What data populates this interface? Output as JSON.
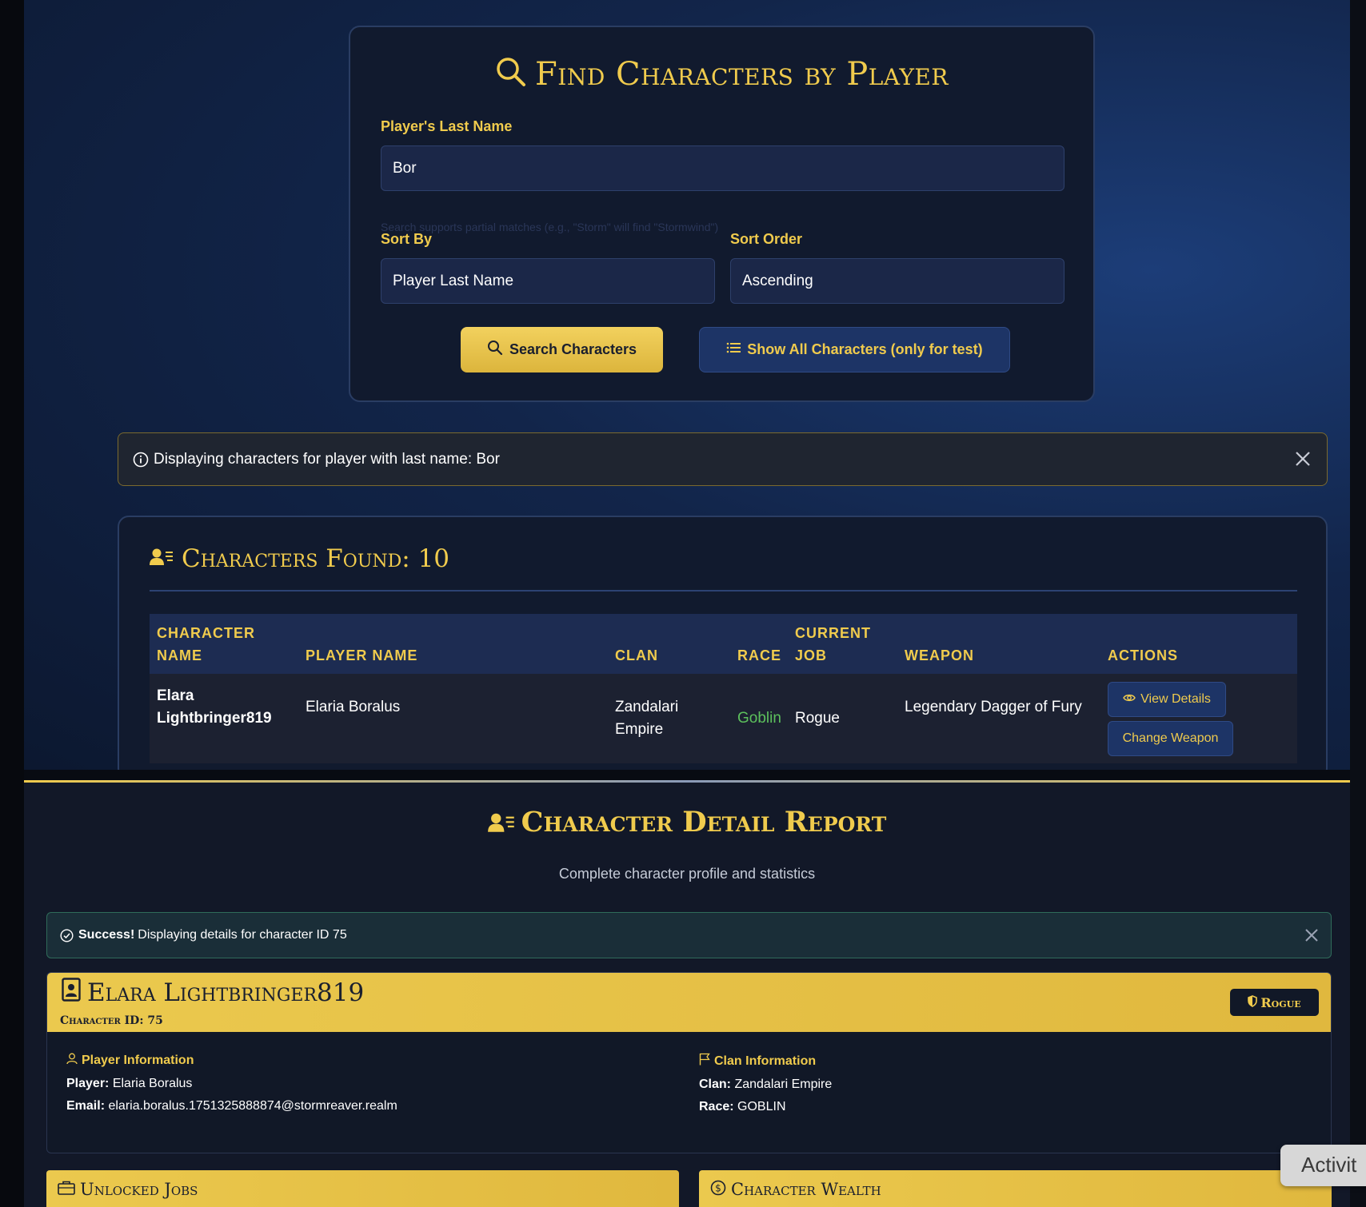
{
  "search": {
    "title": "Find Characters by Player",
    "last_name_label": "Player's Last Name",
    "last_name_value": "Bor",
    "hint": "Search supports partial matches (e.g., \"Storm\" will find \"Stormwind\")",
    "sort_by_label": "Sort By",
    "sort_by_value": "Player Last Name",
    "sort_order_label": "Sort Order",
    "sort_order_value": "Ascending",
    "search_button": "Search Characters",
    "show_all_button": "Show All Characters (only for test)"
  },
  "info_alert": {
    "text": "Displaying characters for player with last name: Bor"
  },
  "results": {
    "title": "Characters Found: 10",
    "columns": {
      "character_name_1": "Character",
      "character_name_2": "Name",
      "player_name": "Player Name",
      "clan": "Clan",
      "race": "Race",
      "current_job_1": "Current",
      "current_job_2": "Job",
      "weapon": "Weapon",
      "actions": "Actions"
    },
    "rows": [
      {
        "character_name_1": "Elara",
        "character_name_2": "Lightbringer819",
        "player_name": "Elaria Boralus",
        "clan_1": "Zandalari",
        "clan_2": "Empire",
        "race": "Goblin",
        "current_job": "Rogue",
        "weapon": "Legendary Dagger of Fury",
        "view_button": "View Details",
        "change_weapon_button": "Change Weapon"
      }
    ]
  },
  "report": {
    "title": "Character Detail Report",
    "subtitle": "Complete character profile and statistics",
    "success_strong": "Success!",
    "success_text": "Displaying details for character ID 75",
    "character_name": "Elara Lightbringer819",
    "character_id": "Character ID: 75",
    "job_badge": "Rogue",
    "player_info_heading": "Player Information",
    "player_label": "Player:",
    "player_value": "Elaria Boralus",
    "email_label": "Email:",
    "email_value": "elaria.boralus.1751325888874@stormreaver.realm",
    "clan_info_heading": "Clan Information",
    "clan_label": "Clan:",
    "clan_value": "Zandalari Empire",
    "race_label": "Race:",
    "race_value": "GOBLIN",
    "unlocked_jobs_heading": "Unlocked Jobs",
    "wealth_heading": "Character Wealth"
  },
  "overlay": {
    "activity_label": "Activit"
  },
  "colors": {
    "accent_gold": "#f0cb4d",
    "navy_card": "#111a2e",
    "race_green": "#5cc05c"
  }
}
